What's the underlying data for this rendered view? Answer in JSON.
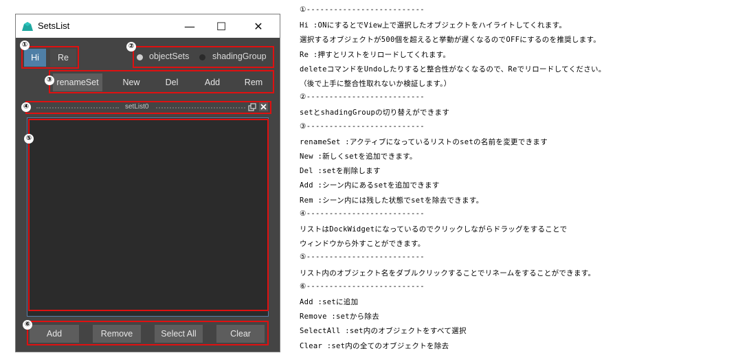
{
  "window": {
    "title": "SetsList",
    "minimize": "—",
    "maximize": "☐",
    "close": "✕"
  },
  "toolbar": {
    "hi_label": "Hi",
    "re_label": "Re",
    "radio_objectsets": "objectSets",
    "radio_shadinggroup": "shadingGroup"
  },
  "action_buttons": {
    "renameset": "renameSet",
    "new": "New",
    "del": "Del",
    "add": "Add",
    "rem": "Rem"
  },
  "dock": {
    "title": "setList0"
  },
  "bottom_buttons": {
    "add": "Add",
    "remove": "Remove",
    "select_all": "Select All",
    "clear": "Clear"
  },
  "markers": [
    "①",
    "②",
    "③",
    "④",
    "⑤",
    "⑥"
  ],
  "icons": [
    "app-icon",
    "minimize-icon",
    "maximize-icon",
    "close-icon",
    "float-icon",
    "dock-close-icon"
  ],
  "colors": {
    "highlight_red": "#e01010",
    "active_blue": "#4f7fa6",
    "panel_gray": "#444444"
  },
  "notes": [
    "①--------------------------",
    "Hi  :ONにするとでView上で選択したオブジェクトをハイライトしてくれます。",
    "    選択するオブジェクトが500個を超えると挙動が遅くなるのでOFFにするのを推奨します。",
    "Re  :押すとリストをリロードしてくれます。",
    "    deleteコマンドをUndoしたりすると整合性がなくなるので、Reでリロードしてください。",
    "    （後で上手に整合性取れないか検証します。）",
    "②--------------------------",
    "setとshadingGroupの切り替えができます",
    "③--------------------------",
    "renameSet    :アクティブになっているリストのsetの名前を変更できます",
    "New          :新しくsetを追加できます。",
    "Del          :setを削除します",
    "Add          :シーン内にあるsetを追加できます",
    "Rem          :シーン内には残した状態でsetを除去できます。",
    "④--------------------------",
    "リストはDockWidgetになっているのでクリックしながらドラッグをすることで",
    "ウィンドウから外すことができます。",
    "⑤--------------------------",
    "リスト内のオブジェクト名をダブルクリックすることでリネームをすることができます。",
    "⑥--------------------------",
    "Add      :setに追加",
    "Remove  :setから除去",
    "SelectAll :set内のオブジェクトをすべて選択",
    "Clear    :set内の全てのオブジェクトを除去"
  ]
}
